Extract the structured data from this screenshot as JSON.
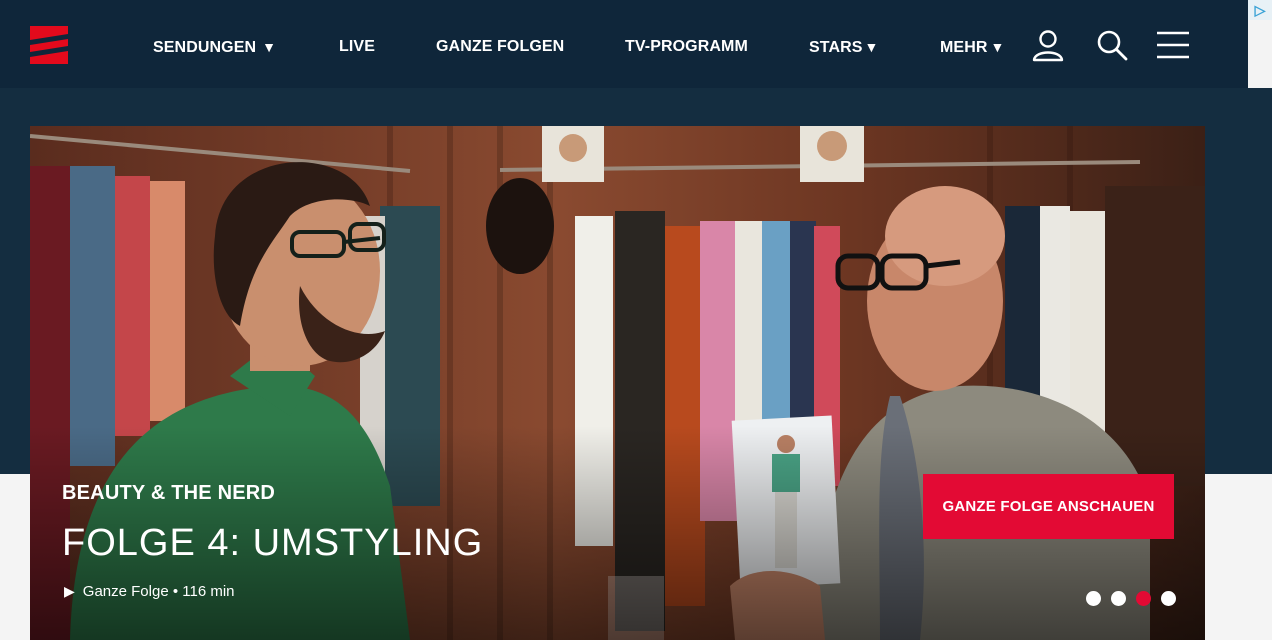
{
  "ad": {
    "badge_icon": "adchoices-icon",
    "label": "▷"
  },
  "header": {
    "logo_name": "prosieben-logo",
    "nav": [
      {
        "label": "SENDUNGEN",
        "has_dropdown": true
      },
      {
        "label": "LIVE",
        "has_dropdown": false
      },
      {
        "label": "GANZE FOLGEN",
        "has_dropdown": false
      },
      {
        "label": "TV-PROGRAMM",
        "has_dropdown": false
      },
      {
        "label": "STARS",
        "has_dropdown": true
      },
      {
        "label": "MEHR",
        "has_dropdown": true
      }
    ],
    "caret": "▼",
    "icons": [
      "user-icon",
      "search-icon",
      "menu-icon"
    ]
  },
  "hero": {
    "show_title": "BEAUTY & THE NERD",
    "episode_title": "FOLGE 4: UMSTYLING",
    "meta_play_icon": "▶",
    "meta_text": "Ganze Folge • 116 min",
    "cta_label": "GANZE FOLGE ANSCHAUEN",
    "carousel": {
      "count": 4,
      "active_index": 2
    }
  },
  "colors": {
    "header_bg": "#0f263a",
    "band_bg": "#142d40",
    "accent_red": "#e30a34"
  }
}
